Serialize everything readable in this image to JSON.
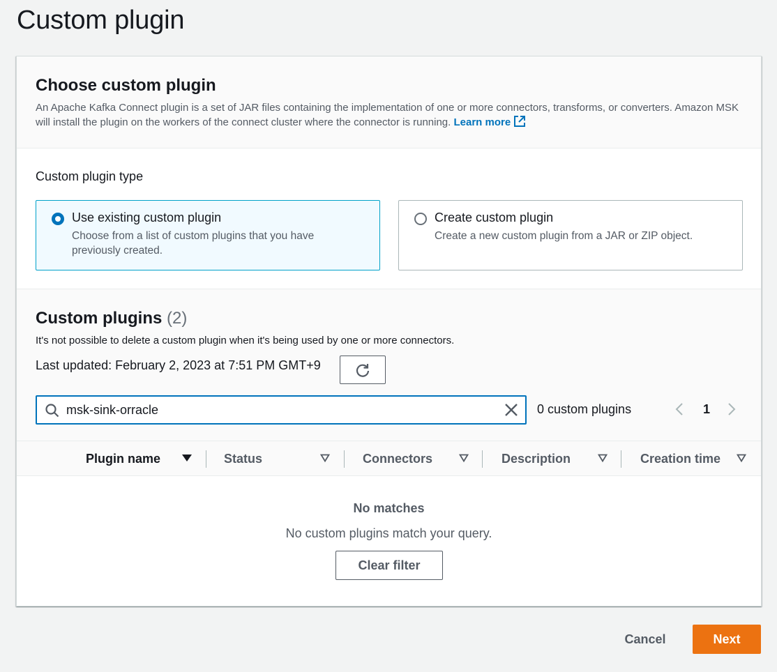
{
  "page": {
    "title": "Custom plugin"
  },
  "choose": {
    "title": "Choose custom plugin",
    "description": "An Apache Kafka Connect plugin is a set of JAR files containing the implementation of one or more connectors, transforms, or converters. Amazon MSK will install the plugin on the workers of the connect cluster where the connector is running.",
    "learn_more": "Learn more",
    "type_label": "Custom plugin type",
    "options": [
      {
        "title": "Use existing custom plugin",
        "description": "Choose from a list of custom plugins that you have previously created.",
        "selected": true
      },
      {
        "title": "Create custom plugin",
        "description": "Create a new custom plugin from a JAR or ZIP object.",
        "selected": false
      }
    ]
  },
  "plugins": {
    "title": "Custom plugins",
    "count": "(2)",
    "description": "It's not possible to delete a custom plugin when it's being used by one or more connectors.",
    "last_updated": "Last updated: February 2, 2023 at 7:51 PM GMT+9",
    "search_value": "msk-sink-orracle",
    "match_count": "0 custom plugins",
    "page_number": "1",
    "columns": [
      "Plugin name",
      "Status",
      "Connectors",
      "Description",
      "Creation time"
    ],
    "empty_title": "No matches",
    "empty_description": "No custom plugins match your query.",
    "clear_filter": "Clear filter"
  },
  "footer": {
    "cancel": "Cancel",
    "next": "Next"
  },
  "colors": {
    "primary": "#ec7211",
    "link": "#0073bb",
    "selected_bg": "#f1faff"
  }
}
